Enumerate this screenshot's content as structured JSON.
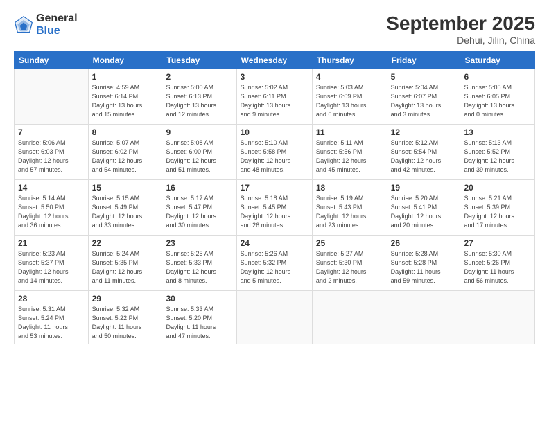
{
  "logo": {
    "general": "General",
    "blue": "Blue"
  },
  "header": {
    "month": "September 2025",
    "location": "Dehui, Jilin, China"
  },
  "weekdays": [
    "Sunday",
    "Monday",
    "Tuesday",
    "Wednesday",
    "Thursday",
    "Friday",
    "Saturday"
  ],
  "weeks": [
    [
      {
        "day": "",
        "info": ""
      },
      {
        "day": "1",
        "info": "Sunrise: 4:59 AM\nSunset: 6:14 PM\nDaylight: 13 hours\nand 15 minutes."
      },
      {
        "day": "2",
        "info": "Sunrise: 5:00 AM\nSunset: 6:13 PM\nDaylight: 13 hours\nand 12 minutes."
      },
      {
        "day": "3",
        "info": "Sunrise: 5:02 AM\nSunset: 6:11 PM\nDaylight: 13 hours\nand 9 minutes."
      },
      {
        "day": "4",
        "info": "Sunrise: 5:03 AM\nSunset: 6:09 PM\nDaylight: 13 hours\nand 6 minutes."
      },
      {
        "day": "5",
        "info": "Sunrise: 5:04 AM\nSunset: 6:07 PM\nDaylight: 13 hours\nand 3 minutes."
      },
      {
        "day": "6",
        "info": "Sunrise: 5:05 AM\nSunset: 6:05 PM\nDaylight: 13 hours\nand 0 minutes."
      }
    ],
    [
      {
        "day": "7",
        "info": "Sunrise: 5:06 AM\nSunset: 6:03 PM\nDaylight: 12 hours\nand 57 minutes."
      },
      {
        "day": "8",
        "info": "Sunrise: 5:07 AM\nSunset: 6:02 PM\nDaylight: 12 hours\nand 54 minutes."
      },
      {
        "day": "9",
        "info": "Sunrise: 5:08 AM\nSunset: 6:00 PM\nDaylight: 12 hours\nand 51 minutes."
      },
      {
        "day": "10",
        "info": "Sunrise: 5:10 AM\nSunset: 5:58 PM\nDaylight: 12 hours\nand 48 minutes."
      },
      {
        "day": "11",
        "info": "Sunrise: 5:11 AM\nSunset: 5:56 PM\nDaylight: 12 hours\nand 45 minutes."
      },
      {
        "day": "12",
        "info": "Sunrise: 5:12 AM\nSunset: 5:54 PM\nDaylight: 12 hours\nand 42 minutes."
      },
      {
        "day": "13",
        "info": "Sunrise: 5:13 AM\nSunset: 5:52 PM\nDaylight: 12 hours\nand 39 minutes."
      }
    ],
    [
      {
        "day": "14",
        "info": "Sunrise: 5:14 AM\nSunset: 5:50 PM\nDaylight: 12 hours\nand 36 minutes."
      },
      {
        "day": "15",
        "info": "Sunrise: 5:15 AM\nSunset: 5:49 PM\nDaylight: 12 hours\nand 33 minutes."
      },
      {
        "day": "16",
        "info": "Sunrise: 5:17 AM\nSunset: 5:47 PM\nDaylight: 12 hours\nand 30 minutes."
      },
      {
        "day": "17",
        "info": "Sunrise: 5:18 AM\nSunset: 5:45 PM\nDaylight: 12 hours\nand 26 minutes."
      },
      {
        "day": "18",
        "info": "Sunrise: 5:19 AM\nSunset: 5:43 PM\nDaylight: 12 hours\nand 23 minutes."
      },
      {
        "day": "19",
        "info": "Sunrise: 5:20 AM\nSunset: 5:41 PM\nDaylight: 12 hours\nand 20 minutes."
      },
      {
        "day": "20",
        "info": "Sunrise: 5:21 AM\nSunset: 5:39 PM\nDaylight: 12 hours\nand 17 minutes."
      }
    ],
    [
      {
        "day": "21",
        "info": "Sunrise: 5:23 AM\nSunset: 5:37 PM\nDaylight: 12 hours\nand 14 minutes."
      },
      {
        "day": "22",
        "info": "Sunrise: 5:24 AM\nSunset: 5:35 PM\nDaylight: 12 hours\nand 11 minutes."
      },
      {
        "day": "23",
        "info": "Sunrise: 5:25 AM\nSunset: 5:33 PM\nDaylight: 12 hours\nand 8 minutes."
      },
      {
        "day": "24",
        "info": "Sunrise: 5:26 AM\nSunset: 5:32 PM\nDaylight: 12 hours\nand 5 minutes."
      },
      {
        "day": "25",
        "info": "Sunrise: 5:27 AM\nSunset: 5:30 PM\nDaylight: 12 hours\nand 2 minutes."
      },
      {
        "day": "26",
        "info": "Sunrise: 5:28 AM\nSunset: 5:28 PM\nDaylight: 11 hours\nand 59 minutes."
      },
      {
        "day": "27",
        "info": "Sunrise: 5:30 AM\nSunset: 5:26 PM\nDaylight: 11 hours\nand 56 minutes."
      }
    ],
    [
      {
        "day": "28",
        "info": "Sunrise: 5:31 AM\nSunset: 5:24 PM\nDaylight: 11 hours\nand 53 minutes."
      },
      {
        "day": "29",
        "info": "Sunrise: 5:32 AM\nSunset: 5:22 PM\nDaylight: 11 hours\nand 50 minutes."
      },
      {
        "day": "30",
        "info": "Sunrise: 5:33 AM\nSunset: 5:20 PM\nDaylight: 11 hours\nand 47 minutes."
      },
      {
        "day": "",
        "info": ""
      },
      {
        "day": "",
        "info": ""
      },
      {
        "day": "",
        "info": ""
      },
      {
        "day": "",
        "info": ""
      }
    ]
  ]
}
